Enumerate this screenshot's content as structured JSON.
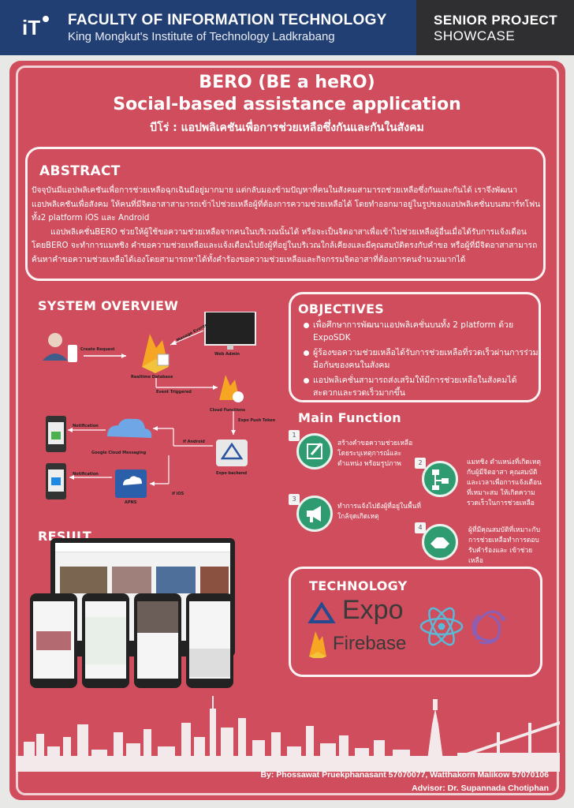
{
  "header": {
    "faculty": "FACULTY OF INFORMATION TECHNOLOGY",
    "institute": "King Mongkut's Institute of Technology Ladkrabang",
    "showcase_line1": "SENIOR PROJECT",
    "showcase_line2": "SHOWCASE",
    "logo_text": "iT",
    "colors": {
      "header_bg": "#223f74",
      "showcase_bg": "#2f2f31",
      "poster_bg": "#cf4d5c",
      "accent_green": "#2e9c70"
    }
  },
  "title": {
    "line1": "BERO (BE a heRO)",
    "line2": "Social-based assistance application",
    "thai": "บีโร่ : แอปพลิเคชันเพื่อการช่วยเหลือซึ่งกันและกันในสังคม"
  },
  "abstract": {
    "heading": "ABSTRACT",
    "para1": "ปัจจุบันมีแอปพลิเคชันเพื่อการช่วยเหลือฉุกเฉินมีอยู่มากมาย แต่กลับมองข้ามปัญหาที่คนในสังคมสามารถช่วยเหลือซึ่งกันและกันได้ เราจึงพัฒนาแอปพลิเคชันเพื่อสังคม ให้คนที่มีจิตอาสาสามารถเข้าไปช่วยเหลือผู้ที่ต้องการความช่วยเหลือได้ โดยทำออกมาอยู่ในรูปของแอปพลิเคชั่นบนสมาร์ทโฟนทั้ง2 platform iOS และ Android",
    "para2": "แอปพลิเคชั่นBERO ช่วยให้ผู้ใช้ขอความช่วยเหลือจากคนในบริเวณนั้นได้ หรือจะเป็นจิตอาสาเพื่อเข้าไปช่วยเหลือผู้อื่นเมื่อได้รับการแจ้งเตือน โดยBERO จะทำการแมทชิง คำขอความช่วยเหลือและแจ้งเตือนไปยังผู้ที่อยู่ในบริเวณใกล้เคียงและมีคุณสมบัติตรงกับคำขอ หรือผู้ที่มีจิตอาสาสามารถค้นหาคำขอความช่วยเหลือได้เองโดยสามารถหาได้ทั้งคำร้องขอความช่วยเหลือและกิจกรรมจิตอาสาที่ต้องการคนจำนวนมากได้"
  },
  "system_overview": {
    "heading": "SYSTEM OVERVIEW",
    "labels": {
      "create_request": "Create Request",
      "realtime_db": "Realtime Database",
      "web_admin": "Web Admin",
      "manage_events": "Manage Events",
      "event_triggered": "Event Triggered",
      "cloud_functions": "Cloud Functions",
      "expo_push": "Expo Push Token",
      "if_android": "if Android",
      "notification1": "Notification",
      "notification2": "Notification",
      "gcm": "Google Cloud Messaging",
      "apns": "APNS",
      "if_ios": "if iOS",
      "expo_backend": "Expo backend"
    }
  },
  "objectives": {
    "heading": "OBJECTIVES",
    "items": [
      "เพื่อศึกษาการพัฒนาแอปพลิเคชั่นบนทั้ง 2 platform ด้วย ExpoSDK",
      "ผู้ร้องขอความช่วยเหลือได้รับการช่วยเหลือที่รวดเร็วผ่านการร่วมมือกันของคนในสังคม",
      "แอปพลิเคชั่นสามารถส่งเสริมให้มีการช่วยเหลือในสังคมได้สะดวกและรวดเร็วมากขึ้น"
    ]
  },
  "main_function": {
    "heading": "Main Function",
    "items": [
      {
        "num": "1",
        "text": "สร้างคำขอความช่วยเหลือ โดยระบุเหตุการณ์และตำแหน่ง พร้อมรูปภาพ"
      },
      {
        "num": "2",
        "text": "แมทชิง ตำแหน่งที่เกิดเหตุกับผู้มีจิตอาสา คุณสมบัติ และเวลาเพื่อการแจ้งเตือน ที่เหมาะสม ให้เกิดความรวดเร็วในการช่วยเหลือ"
      },
      {
        "num": "3",
        "text": "ทำการแจ้งไปยังผู้ที่อยู่ในพื้นที่ใกล้จุดเกิดเหตุ"
      },
      {
        "num": "4",
        "text": "ผู้ที่มีคุณสมบัติที่เหมาะกับการช่วยเหลือทำการตอบรับคำร้องและ เข้าช่วยเหลือ"
      }
    ]
  },
  "result": {
    "heading": "RESULT"
  },
  "technology": {
    "heading": "TECHNOLOGY",
    "expo": "Expo",
    "firebase": "Firebase"
  },
  "footer": {
    "by": "By: Phossawat Pruekphanasant 57070077, Watthakorn Malikow 57070106",
    "advisor": "Advisor: Dr. Supannada Chotiphan"
  }
}
